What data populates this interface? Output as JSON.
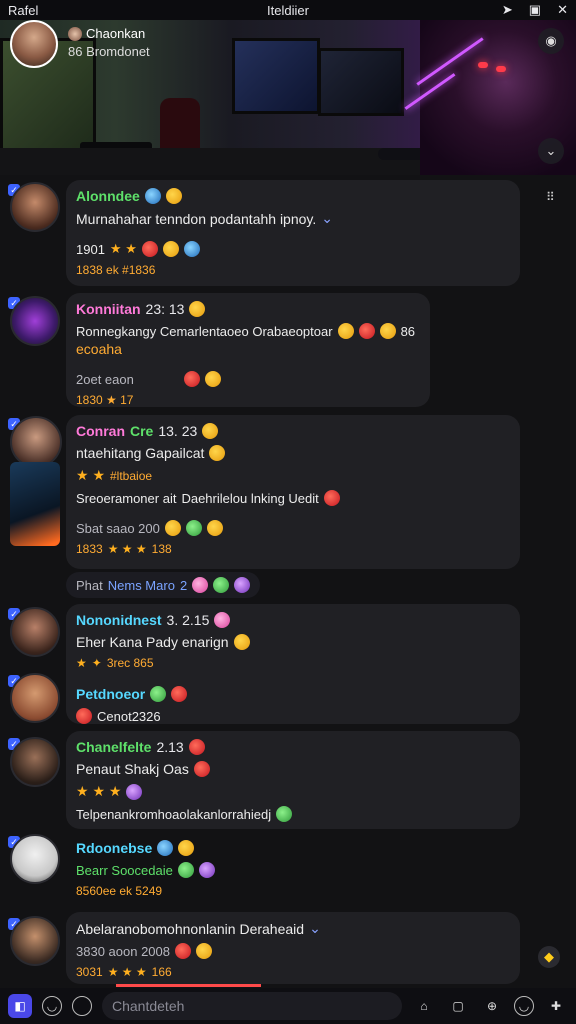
{
  "topbar": {
    "left": "Rafel",
    "center": "Iteldiier",
    "icons": [
      "send-icon",
      "square-icon",
      "close-icon"
    ]
  },
  "hero": {
    "channel_name": "Chaonkan",
    "channel_sub": "86  Bromdonet"
  },
  "messages": [
    {
      "name": "Alonndee",
      "name_color": "#5ee06a",
      "line1": "Murnahahar tenndon podantahh ipnoy.",
      "line2": "1901",
      "line3": "1838 ek #1836"
    },
    {
      "name": "Konniitan",
      "time": "23: 13",
      "name_color": "#ff7ad9",
      "line1": "Ronnegkangy Cemarlentaoeo Orabaeoptoar",
      "line1_tail": "86",
      "line2": "ecoaha",
      "line3": "2oet eaon",
      "line4": "1830 ★ 17"
    },
    {
      "name": "Conran",
      "tag": "Cre",
      "time": "13. 23",
      "name_color": "#ff7ad9",
      "line1": "ntaehitang Gapailcat",
      "line2": "Sreoeramoner ait",
      "line2_tail": "Daehrilelou lnking Uedit",
      "line3": "Sbat saao 200",
      "line4": "1833",
      "line4_tail": "138"
    },
    {
      "separator": "Phat",
      "separator_tag": "Nems Maro",
      "separator_num": "2"
    },
    {
      "name": "Nononidnest",
      "time": "3. 2.15",
      "name_color": "#56d8ff",
      "line1": "Eher Kana Pady enarign",
      "line2": "3rec 865"
    },
    {
      "name": "Petdnoeor",
      "name_color": "#56d8ff",
      "line1": "Cenot2326"
    },
    {
      "name": "Chanelfelte",
      "time": "2.13",
      "name_color": "#5ee06a",
      "line1": "Penaut Shakj Oas",
      "line2": "Telpenankromhoaolakanlorrahiedj"
    },
    {
      "name": "Rdoonebse",
      "name_color": "#56d8ff",
      "line1": "Bearr Soocedaie",
      "line2": "8560ee ek 5249"
    },
    {
      "name": "",
      "line1": "Abelaranobomohnonlanin Deraheaid",
      "line2": "3830 aoon 2008",
      "line3": "3031",
      "line3_tail": "166"
    }
  ],
  "bottom": {
    "composer_placeholder": "Chantdeteh"
  },
  "colors": {
    "accent": "#3d63ff",
    "progress": "#ff4a4a",
    "star": "#ffb01f"
  }
}
